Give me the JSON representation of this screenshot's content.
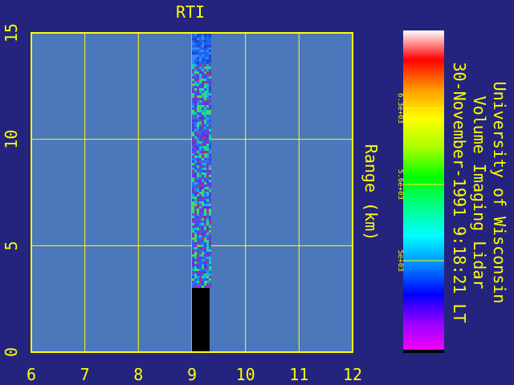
{
  "chart_data": {
    "type": "heatmap",
    "title": "RTI",
    "ylabel": "Range (km)",
    "xlim": [
      6,
      12
    ],
    "ylim": [
      0,
      15
    ],
    "x_ticks": [
      "6",
      "7",
      "8",
      "9",
      "10",
      "11",
      "12"
    ],
    "y_ticks": [
      "0",
      "5",
      "10",
      "15"
    ],
    "grid": true,
    "data_column": {
      "x_start": 9.0,
      "x_end": 9.33,
      "blank_range": [
        0,
        3.1
      ],
      "data_range": [
        3.1,
        15
      ],
      "low_signal_above": 13.6
    },
    "colorbar": {
      "tick_labels": [
        "6.3e+03",
        "5.6e+03",
        "5e+03"
      ],
      "colors": [
        "#ff00ff",
        "#9900ff",
        "#0000ff",
        "#0088ff",
        "#00ffff",
        "#00ff88",
        "#00ff00",
        "#aaff00",
        "#ffff00",
        "#ff9900",
        "#ff0000",
        "#ffffff"
      ]
    },
    "annotations": {
      "institution": "University of Wisconsin",
      "instrument": "Volume Imaging Lidar",
      "timestamp": "30-November-1991 9:18:21 LT"
    }
  },
  "colors": {
    "background": "#24247e",
    "plot_area": "#4b77bb",
    "axis": "#ffff00",
    "text": "#ffff00",
    "blank": "#000000"
  }
}
